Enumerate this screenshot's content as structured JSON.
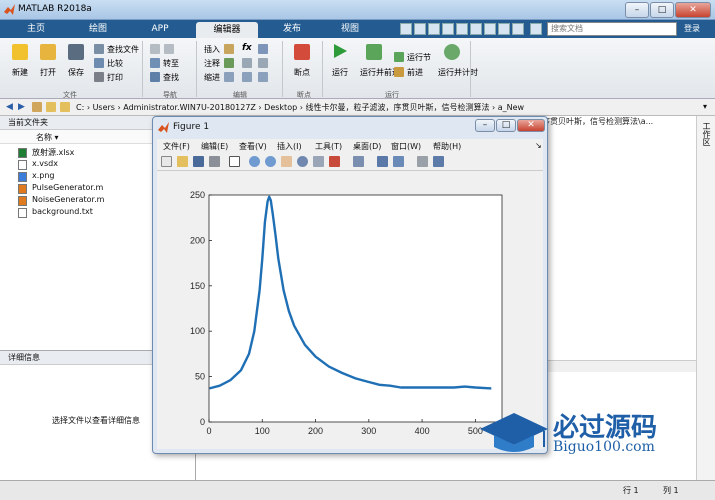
{
  "window": {
    "title": "MATLAB R2018a"
  },
  "tabs": [
    {
      "label": "主页"
    },
    {
      "label": "绘图"
    },
    {
      "label": "APP"
    },
    {
      "label": "编辑器",
      "active": true
    },
    {
      "label": "发布"
    },
    {
      "label": "视图"
    }
  ],
  "search": {
    "placeholder": "搜索文档"
  },
  "help_label": "登录",
  "ribbon": {
    "file": {
      "section": "文件",
      "new": "新建",
      "open": "打开",
      "save": "保存",
      "find_files": "查找文件",
      "compare": "比较",
      "print": "打印"
    },
    "navigate": {
      "section": "导航",
      "goto": "转至",
      "find": "查找"
    },
    "edit": {
      "section": "编辑",
      "insert": "插入",
      "comment": "注释",
      "indent": "缩进",
      "fx": "fx"
    },
    "breakpoints": {
      "section": "断点",
      "breakpoints": "断点"
    },
    "run": {
      "section": "运行",
      "run": "运行",
      "run_advance": "运行并前进",
      "run_section": "运行节",
      "advance": "前进",
      "run_time": "运行并计时"
    }
  },
  "address": {
    "path": "C: › Users › Administrator.WIN7U-20180127Z › Desktop › 线性卡尔曼，粒子滤波，序贯贝叶斯，信号检测算法 › a_New"
  },
  "current_folder": {
    "title": "当前文件夹",
    "col_name": "名称 ▾",
    "files": [
      {
        "name": "放射源.xlsx",
        "icon": "excel-icon",
        "color": "#1e7e34"
      },
      {
        "name": "x.vsdx",
        "icon": "doc-icon",
        "color": "#ffffff"
      },
      {
        "name": "x.png",
        "icon": "image-icon",
        "color": "#3b7dd8"
      },
      {
        "name": "PulseGenerator.m",
        "icon": "m-file-icon",
        "color": "#e07a1f"
      },
      {
        "name": "NoiseGenerator.m",
        "icon": "m-file-icon",
        "color": "#e07a1f"
      },
      {
        "name": "background.txt",
        "icon": "txt-icon",
        "color": "#ffffff"
      }
    ]
  },
  "details": {
    "title": "详细信息",
    "empty_text": "选择文件以查看详细信息"
  },
  "editor_header": "序贯贝叶斯，信号检测算法\\a...",
  "workspace_label": "工作区",
  "status": {
    "row_label": "行",
    "row": "1",
    "col_label": "列",
    "col": "1"
  },
  "figure": {
    "title": "Figure 1",
    "menus": [
      "文件(F)",
      "编辑(E)",
      "查看(V)",
      "插入(I)",
      "工具(T)",
      "桌面(D)",
      "窗口(W)",
      "帮助(H)"
    ]
  },
  "chart_data": {
    "type": "line",
    "title": "",
    "xlabel": "",
    "ylabel": "",
    "xlim": [
      0,
      550
    ],
    "ylim": [
      0,
      250
    ],
    "xticks": [
      0,
      100,
      200,
      300,
      400,
      500
    ],
    "yticks": [
      0,
      50,
      100,
      150,
      200,
      250
    ],
    "color": "#1f6fb5",
    "series": [
      {
        "x": [
          1,
          20,
          40,
          60,
          75,
          85,
          95,
          100,
          105,
          110,
          113,
          116,
          120,
          125,
          130,
          140,
          150,
          160,
          180,
          200,
          225,
          250,
          275,
          300,
          320,
          340,
          360,
          380,
          400,
          420,
          440,
          460,
          480,
          500,
          530
        ],
        "y": [
          37,
          40,
          46,
          57,
          75,
          100,
          145,
          180,
          220,
          243,
          248,
          244,
          228,
          205,
          180,
          145,
          122,
          106,
          85,
          72,
          61,
          54,
          48,
          44,
          41,
          40,
          38,
          38,
          38,
          38,
          38,
          38,
          39,
          38,
          37
        ]
      }
    ]
  },
  "watermark": {
    "cn": "必过源码",
    "en": "Biguo100.com"
  }
}
